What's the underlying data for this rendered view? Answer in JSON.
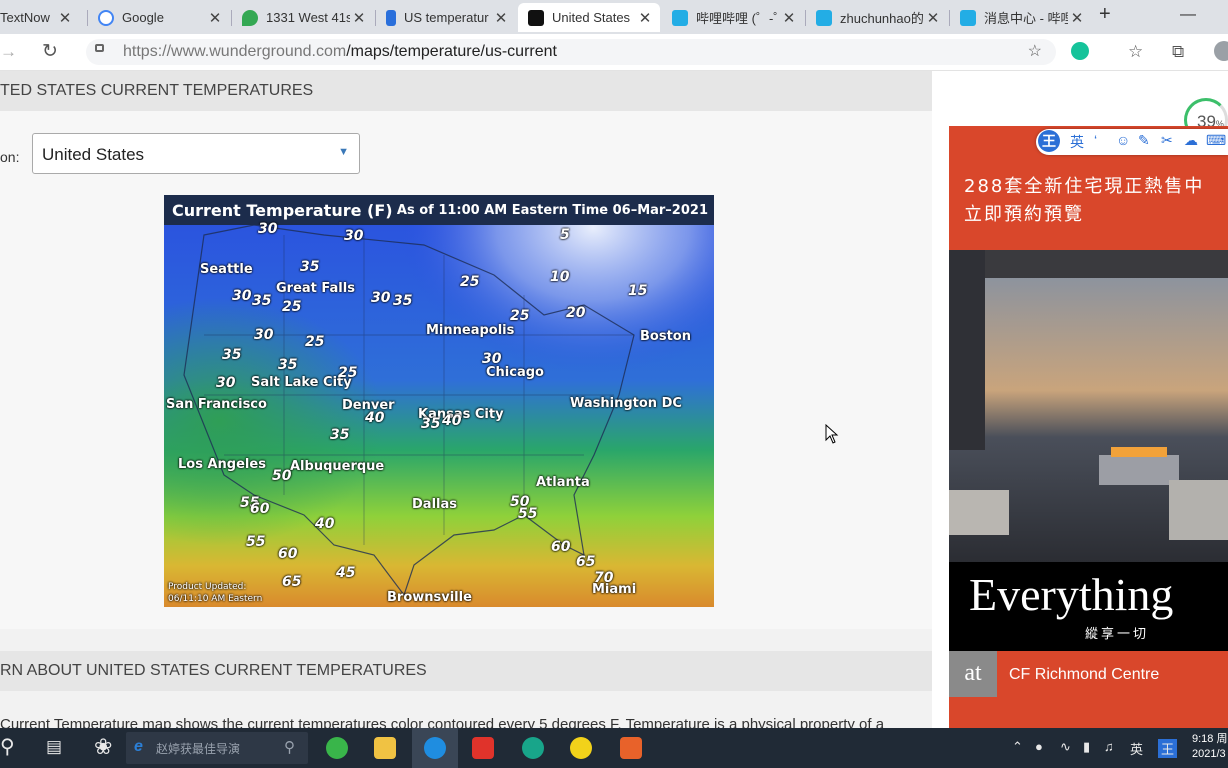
{
  "browser": {
    "tabs": [
      {
        "title": "TextNow",
        "color": "#7b2fbf"
      },
      {
        "title": "Google",
        "color": "#4285f4"
      },
      {
        "title": "1331 West 41s",
        "color": "#34a853"
      },
      {
        "title": "US temperatur",
        "color": "#2a6fdb"
      },
      {
        "title": "United States",
        "color": "#111111",
        "active": true
      },
      {
        "title": "哔哩哔哩 (゜-゜",
        "color": "#23ade5"
      },
      {
        "title": "zhuchunhao的",
        "color": "#23ade5"
      },
      {
        "title": "消息中心 - 哔哩",
        "color": "#23ade5"
      }
    ],
    "close_glyph": "✕",
    "new_tab_glyph": "+",
    "url_host": "https://www.wunderground.com",
    "url_path": "/maps/temperature/us-current",
    "icons": [
      "back-icon",
      "refresh-icon",
      "lock-icon",
      "favorite-add-icon",
      "grammarly-icon",
      "favorites-icon",
      "collections-icon",
      "profile-icon"
    ]
  },
  "page": {
    "section1_title": "TED STATES CURRENT TEMPERATURES",
    "region_label": "on:",
    "region_value": "United States",
    "section2_title": "RN ABOUT UNITED STATES CURRENT TEMPERATURES",
    "paragraph": "Current Temperature map shows the current temperatures color contoured every 5 degrees F. Temperature is a physical property of a"
  },
  "map": {
    "title": "Current Temperature (F)",
    "timestamp": "As of 11:00  AM Eastern Time  06–Mar–2021",
    "footer_line1": "Product Updated:",
    "footer_line2": "06/11:10 AM Eastern",
    "cities": [
      "Seattle",
      "Great Falls",
      "Minneapolis",
      "Boston",
      "Chicago",
      "Salt Lake City",
      "San Francisco",
      "Denver",
      "Kansas City",
      "Washington DC",
      "Los Angeles",
      "Albuquerque",
      "Atlanta",
      "Dallas",
      "Brownsville",
      "Miami"
    ],
    "temps": [
      "30",
      "30",
      "5",
      "35",
      "10",
      "25",
      "15",
      "30",
      "35",
      "30",
      "35",
      "25",
      "20",
      "25",
      "25",
      "30",
      "35",
      "35",
      "30",
      "25",
      "30",
      "40",
      "35",
      "40",
      "35",
      "50",
      "55",
      "60",
      "50",
      "55",
      "40",
      "55",
      "60",
      "60",
      "65",
      "65",
      "45",
      "70"
    ]
  },
  "ad": {
    "headline1": "288套全新住宅現正熱售中",
    "headline2": "立即預約預覽",
    "slogan": "Everything",
    "slogan_cn": "縱享一切",
    "at": "at",
    "brand": "CF Richmond Centre"
  },
  "ime": {
    "mode_char": "王",
    "lang_char": "英"
  },
  "gauge": {
    "value": "39",
    "unit": "%"
  },
  "taskbar": {
    "search_placeholder": "赵婷获最佳导演",
    "tray_lang": "英",
    "tray_ime": "王",
    "time": "9:18 周",
    "date": "2021/3"
  }
}
